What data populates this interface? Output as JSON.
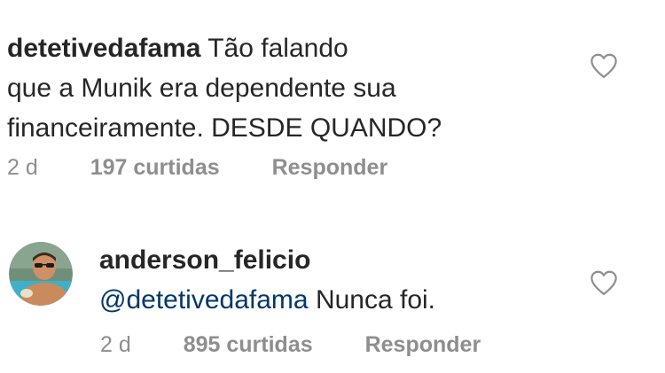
{
  "comments": [
    {
      "username": "detetivedafama",
      "text_lines": [
        "Tão falando",
        "que a Munik era dependente sua",
        "financeiramente. DESDE QUANDO?"
      ],
      "time": "2 d",
      "likes": "197 curtidas",
      "reply": "Responder",
      "like_icon": "heart-outline-icon"
    },
    {
      "username": "anderson_felicio",
      "mention": "@detetivedafama",
      "text": "Nunca foi.",
      "time": "2 d",
      "likes": "895 curtidas",
      "reply": "Responder",
      "like_icon": "heart-outline-icon"
    }
  ],
  "colors": {
    "text": "#262626",
    "secondary": "#8e8e8e",
    "mention": "#00376b"
  }
}
